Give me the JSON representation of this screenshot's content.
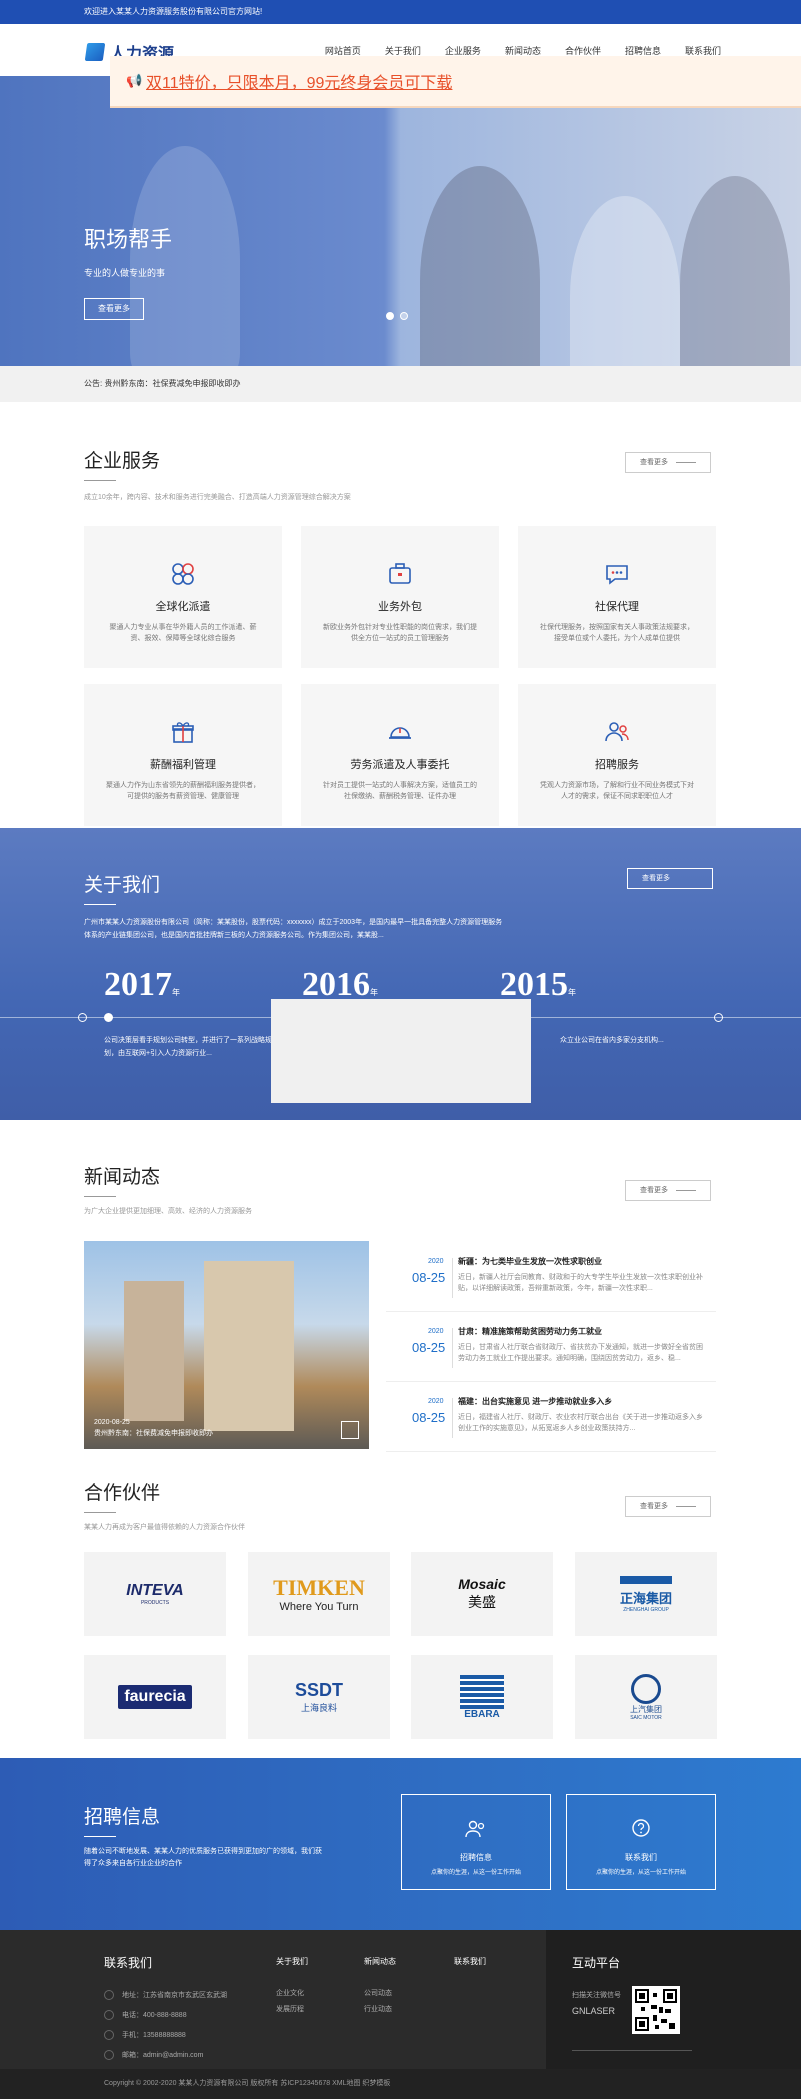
{
  "topbar": {
    "text": "欢迎进入某某人力资源服务股份有限公司官方网站!"
  },
  "logo": {
    "text": "人力资源"
  },
  "nav": [
    "网站首页",
    "关于我们",
    "企业服务",
    "新闻动态",
    "合作伙伴",
    "招聘信息",
    "联系我们"
  ],
  "promo": {
    "icon": "megaphone-icon",
    "text": "双11特价，只限本月，99元终身会员可下载"
  },
  "hero": {
    "title": "职场帮手",
    "subtitle": "专业的人做专业的事",
    "button": "查看更多",
    "slides": 2,
    "active_slide": 1
  },
  "notice": {
    "text": "公告:  贵州黔东南：社保费减免申报即收即办"
  },
  "services": {
    "title": "企业服务",
    "desc": "成立10余年，跨内容、技术和服务进行完美融合、打造高端人力资源管理综合解决方案",
    "more": "查看更多",
    "items": [
      {
        "title": "全球化派遣",
        "desc": "聚通人力专业从事在华外籍人员的工作派遣、薪资、报效、保障等全球化综合服务",
        "icon": "global-icon"
      },
      {
        "title": "业务外包",
        "desc": "新欧业务外包针对专业性职能的岗位需求，我们提供全方位一站式的员工管理服务",
        "icon": "briefcase-icon"
      },
      {
        "title": "社保代理",
        "desc": "社保代理服务，按照国家有关人事政策法规要求，接受单位或个人委托，为个人成单位提供",
        "icon": "chat-icon"
      },
      {
        "title": "薪酬福利管理",
        "desc": "聚通人力作为山东省领先的薪酬福利服务提供者，可提供的服务有薪资管理、健康管理",
        "icon": "gift-icon"
      },
      {
        "title": "劳务派遣及人事委托",
        "desc": "针对员工提供一站式的人事解决方案，适值员工的社保缴纳、薪酬税务管理、证件办理",
        "icon": "helmet-icon"
      },
      {
        "title": "招聘服务",
        "desc": "凭观人力资源市场，了解和行业不同业务模式下对人才的需求，保证不同求职职位人才",
        "icon": "users-icon"
      }
    ]
  },
  "about": {
    "title": "关于我们",
    "more": "查看更多",
    "para": "广州市某某人力资源股份有限公司（简称：某某股份，股票代码：xxxxxxx）成立于2003年，是国内最早一批具备完整人力资源管理服务体系的产业链集团公司，也是国内首批挂牌新三板的人力资源服务公司。作为集团公司，某某股...",
    "years": [
      {
        "year": "2017",
        "unit": "年"
      },
      {
        "year": "2016",
        "unit": "年"
      },
      {
        "year": "2015",
        "unit": "年"
      }
    ],
    "story_left": "公司决策层看手规划公司转型，并进行了一系列战略规划，由互联网+引入人力资源行业...",
    "story_right": "众立业公司在省内多家分支机构..."
  },
  "news": {
    "title": "新闻动态",
    "desc": "为广大企业提供更加细理、高效、经济的人力资源服务",
    "more": "查看更多",
    "feature": {
      "date": "2020-08-25",
      "caption": "贵州黔东南：社保费减免申报即收即办"
    },
    "items": [
      {
        "year": "2020",
        "date": "08-25",
        "title": "新疆：为七类毕业生发放一次性求职创业",
        "summary": "近日，新疆人社厅会同教育、财政和于的大专学生毕业生发放一次性求职创业补贴，以详细解读政策，吾辩重新政策，今年，新疆一次性求职..."
      },
      {
        "year": "2020",
        "date": "08-25",
        "title": "甘肃：精准施策帮助贫困劳动力务工就业",
        "summary": "近日，甘肃省人社厅联合省财政厅、省扶贫办下发通知，就进一步做好全省贫困劳动力务工就业工作提出要求。通知明确，围绕因贫劳动力，返乡、稳..."
      },
      {
        "year": "2020",
        "date": "08-25",
        "title": "福建：出台实施意见 进一步推动就业多入乡",
        "summary": "近日，福建省人社厅、财政厅、农业农村厅联合出台《关于进一步推动返多入乡创业工作的实施意见》，从拓宽返乡人乡创业政策扶持方..."
      }
    ]
  },
  "partners": {
    "title": "合作伙伴",
    "desc": "某某人力再成为客户最值得依赖的人力资源合作伙伴",
    "more": "查看更多",
    "logos": [
      {
        "name": "INTEVA",
        "sub": "PRODUCTS",
        "color": "#1d2b6b",
        "icon": "inteva-logo"
      },
      {
        "name": "TIMKEN",
        "sub": "Where You Turn",
        "color": "#e09a1c",
        "icon": "timken-logo"
      },
      {
        "name": "Mosaic",
        "sub": "美盛",
        "color": "#111111",
        "icon": "mosaic-logo"
      },
      {
        "name": "正海集团",
        "sub": "ZHENGHAI GROUP",
        "color": "#1a5aa6",
        "icon": "zhenghai-logo"
      },
      {
        "name": "faurecia",
        "sub": "",
        "color": "#1b2b72",
        "icon": "faurecia-logo"
      },
      {
        "name": "SSDT",
        "sub": "上海良料",
        "color": "#1d4c9a",
        "icon": "ssdt-logo"
      },
      {
        "name": "EBARA",
        "sub": "",
        "color": "#1a5aa6",
        "icon": "ebara-logo"
      },
      {
        "name": "上汽集团",
        "sub": "SAIC MOTOR",
        "color": "#1a4a8f",
        "icon": "saic-logo"
      }
    ]
  },
  "recruit": {
    "title": "招聘信息",
    "para": "随着公司不断地发展、某某人力的优质服务已获得到更加的广的领域，我们获得了众多来自各行业企业的合作",
    "boxes": [
      {
        "title": "招聘信息",
        "sub": "点聚你的生涯，从这一份工作开始",
        "icon": "people-icon"
      },
      {
        "title": "联系我们",
        "sub": "点聚你的生涯，从这一份工作开始",
        "icon": "question-icon"
      }
    ]
  },
  "footer": {
    "contact_title": "联系我们",
    "contacts": [
      {
        "label": "地址：江苏省南京市玄武区玄武湖",
        "icon": "location-icon"
      },
      {
        "label": "电话：400-888-8888",
        "icon": "phone-icon"
      },
      {
        "label": "手机：13588888888",
        "icon": "mobile-icon"
      },
      {
        "label": "邮箱：admin@admin.com",
        "icon": "mail-icon"
      }
    ],
    "cols": [
      {
        "title": "关于我们",
        "links": [
          "企业文化",
          "发展历程"
        ]
      },
      {
        "title": "新闻动态",
        "links": [
          "公司动态",
          "行业动态"
        ]
      },
      {
        "title": "联系我们",
        "links": []
      }
    ],
    "platform_title": "互动平台",
    "platform_text": "扫描关注微信号",
    "platform_brand": "GNLASER",
    "copyright": "Copyright © 2002-2020 某某人力资源有限公司 版权所有 苏ICP12345678 XML地图 织梦模板"
  }
}
